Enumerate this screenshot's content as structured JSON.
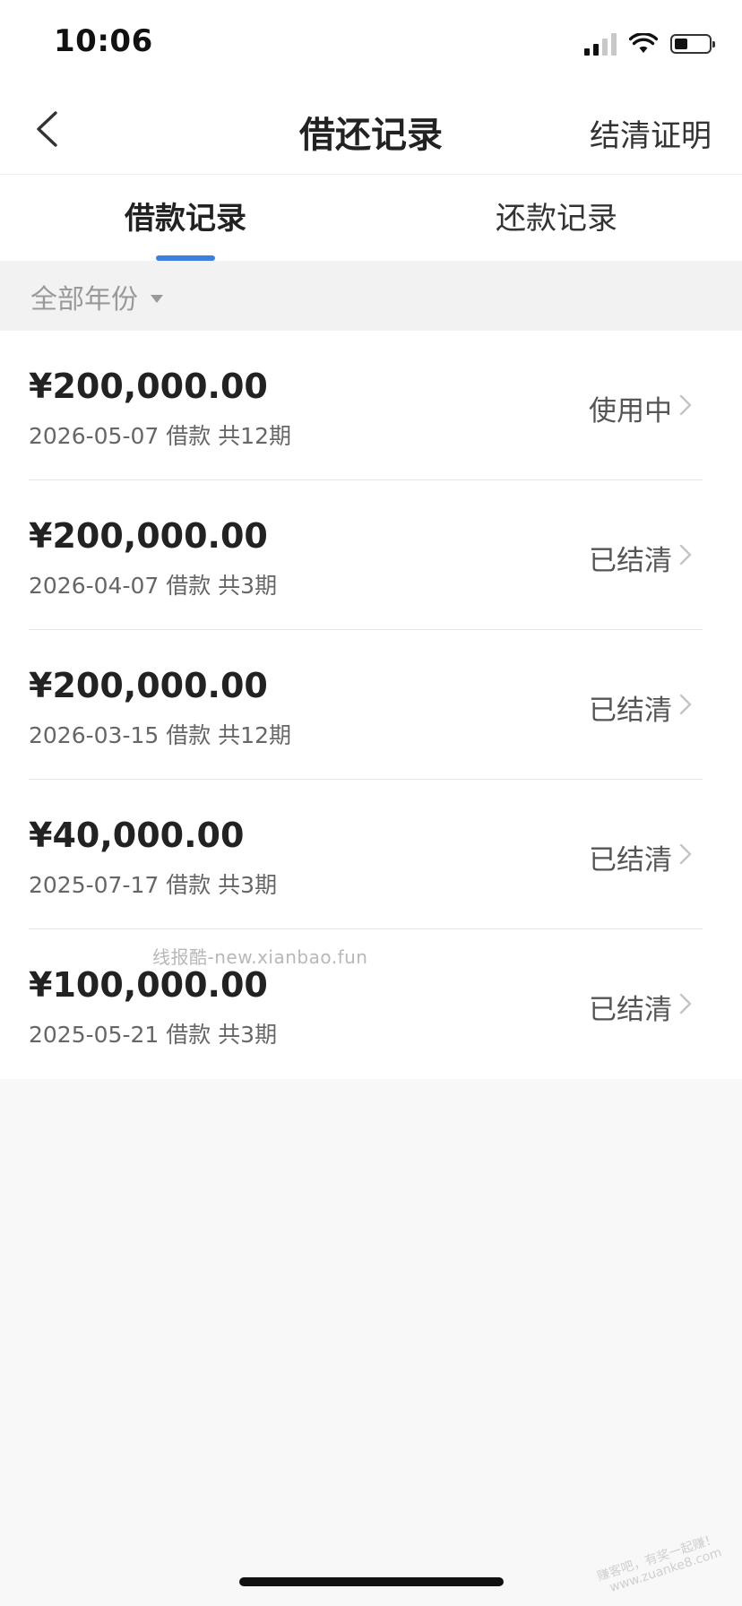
{
  "status_bar": {
    "time": "10:06"
  },
  "nav": {
    "title": "借还记录",
    "right_action": "结清证明",
    "back_icon": "chevron-left-icon"
  },
  "tabs": [
    {
      "label": "借款记录",
      "active": true
    },
    {
      "label": "还款记录",
      "active": false
    }
  ],
  "filter": {
    "label": "全部年份"
  },
  "loans": [
    {
      "amount": "¥200,000.00",
      "meta": "2026-05-07 借款 共12期",
      "status": "使用中"
    },
    {
      "amount": "¥200,000.00",
      "meta": "2026-04-07 借款 共3期",
      "status": "已结清"
    },
    {
      "amount": "¥200,000.00",
      "meta": "2026-03-15 借款 共12期",
      "status": "已结清"
    },
    {
      "amount": "¥40,000.00",
      "meta": "2025-07-17 借款 共3期",
      "status": "已结清"
    },
    {
      "amount": "¥100,000.00",
      "meta": "2025-05-21 借款 共3期",
      "status": "已结清"
    }
  ],
  "watermark": {
    "text": "线报酷-new.xianbao.fun",
    "corner_line1": "赚客吧，有奖一起赚！",
    "corner_line2": "www.zuanke8.com"
  },
  "colors": {
    "accent": "#3b7fe0",
    "background": "#f8f8f8",
    "card": "#ffffff"
  }
}
